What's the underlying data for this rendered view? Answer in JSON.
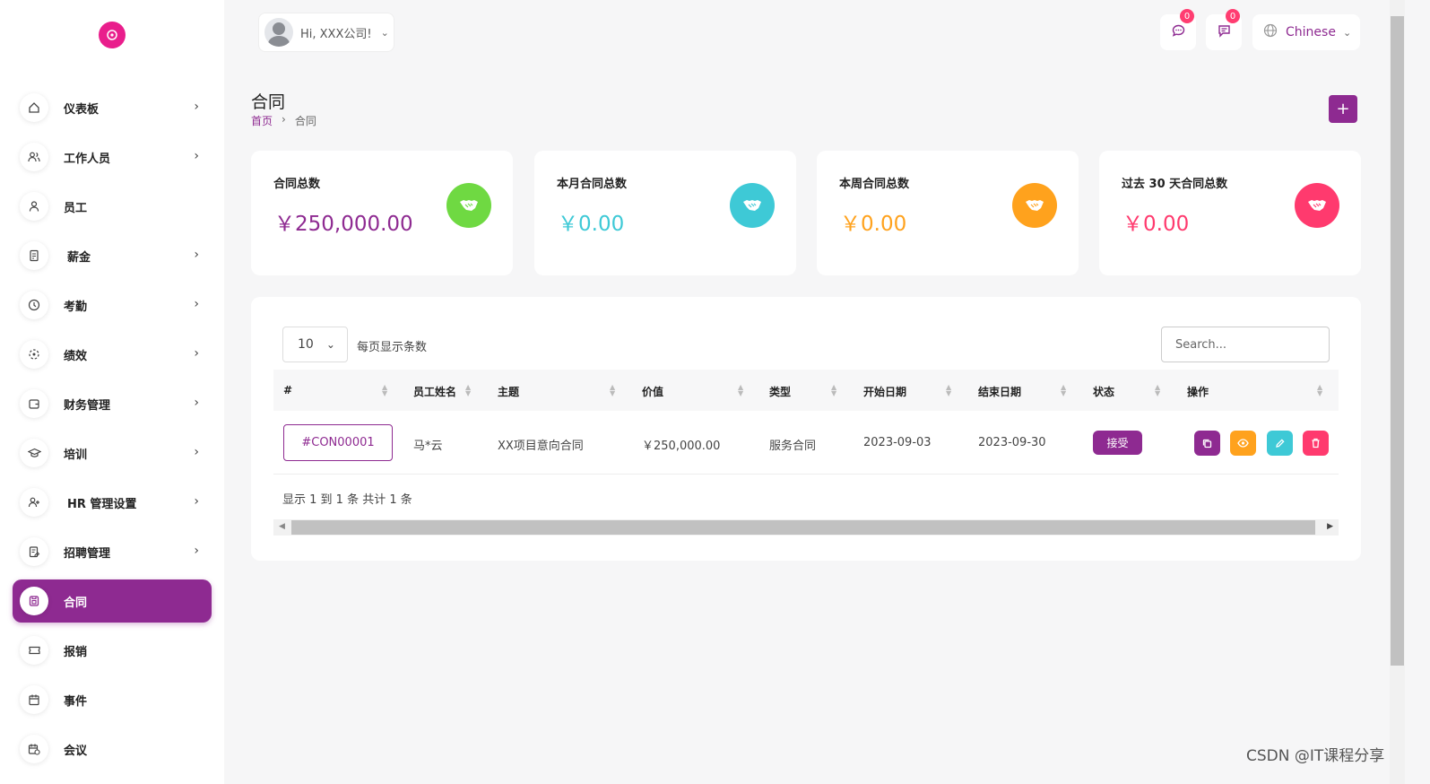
{
  "user": {
    "greeting": "Hi, XXX公司!"
  },
  "topbar": {
    "chat_count": "0",
    "message_count": "0",
    "language": "Chinese"
  },
  "sidebar": {
    "items": [
      {
        "label": "仪表板",
        "icon": "home-icon",
        "has_arrow": true
      },
      {
        "label": "工作人员",
        "icon": "users-icon",
        "has_arrow": true
      },
      {
        "label": "员工",
        "icon": "user-icon",
        "has_arrow": false
      },
      {
        "label": "薪金",
        "icon": "receipt-icon",
        "has_arrow": true
      },
      {
        "label": "考勤",
        "icon": "clock-icon",
        "has_arrow": true
      },
      {
        "label": "绩效",
        "icon": "target-icon",
        "has_arrow": true
      },
      {
        "label": "财务管理",
        "icon": "wallet-icon",
        "has_arrow": true
      },
      {
        "label": "培训",
        "icon": "graduation-cap-icon",
        "has_arrow": true
      },
      {
        "label": "HR 管理设置",
        "icon": "user-plus-icon",
        "has_arrow": true
      },
      {
        "label": "招聘管理",
        "icon": "clipboard-icon",
        "has_arrow": true
      },
      {
        "label": "合同",
        "icon": "file-icon",
        "has_arrow": false,
        "active": true
      },
      {
        "label": "报销",
        "icon": "ticket-icon",
        "has_arrow": false
      },
      {
        "label": "事件",
        "icon": "calendar-icon",
        "has_arrow": false
      },
      {
        "label": "会议",
        "icon": "calendar-clock-icon",
        "has_arrow": false
      }
    ]
  },
  "page": {
    "title": "合同",
    "breadcrumb_home": "首页",
    "breadcrumb_current": "合同",
    "add_label": "+"
  },
  "stats": [
    {
      "title": "合同总数",
      "value": "￥250,000.00",
      "color": "#8e2a91",
      "icon_bg": "#6fd942"
    },
    {
      "title": "本月合同总数",
      "value": "￥0.00",
      "color": "#3ec9d6",
      "icon_bg": "#3ec9d6"
    },
    {
      "title": "本周合同总数",
      "value": "￥0.00",
      "color": "#ffa21d",
      "icon_bg": "#ffa21d"
    },
    {
      "title": "过去 30 天合同总数",
      "value": "￥0.00",
      "color": "#ff3a6e",
      "icon_bg": "#ff3a6e"
    }
  ],
  "table": {
    "per_page": "10",
    "per_page_label": "每页显示条数",
    "search_placeholder": "Search...",
    "columns": [
      "#",
      "员工姓名",
      "主题",
      "价值",
      "类型",
      "开始日期",
      "结束日期",
      "状态",
      "操作"
    ],
    "rows": [
      {
        "id": "#CON00001",
        "employee": "马*云",
        "subject": "XX项目意向合同",
        "value": "￥250,000.00",
        "type": "服务合同",
        "start": "2023-09-03",
        "end": "2023-09-30",
        "status": "接受"
      }
    ],
    "summary": "显示 1 到 1 条 共计 1 条"
  },
  "colors": {
    "primary": "#8e2a91",
    "copy": "#8e2a91",
    "view": "#ffa21d",
    "edit": "#3ec9d6",
    "delete": "#ff3a6e"
  },
  "watermark": "CSDN @IT课程分享"
}
